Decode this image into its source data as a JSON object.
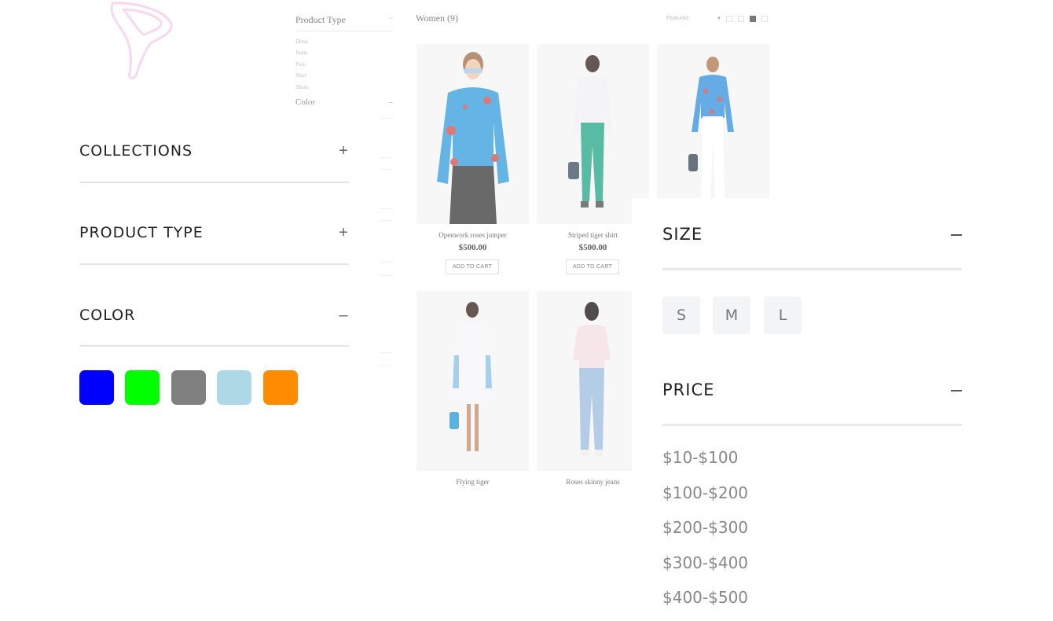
{
  "shop": {
    "filters_small": {
      "product_type_title": "Product Type",
      "types": [
        "Dress",
        "Jeans",
        "Polo",
        "Shirt",
        "Shoes"
      ],
      "color_title": "Color",
      "toggle": "–"
    },
    "heading": "Women (9)",
    "sort_label": "Featured",
    "products": [
      {
        "name": "Openwork roses jumper",
        "price": "$500.00",
        "cta": "ADD TO CART"
      },
      {
        "name": "Striped tiger shirt",
        "price": "$500.00",
        "cta": "ADD TO CART"
      },
      {
        "name": "",
        "price": "",
        "cta": ""
      },
      {
        "name": "Flying tiger",
        "price": "",
        "cta": ""
      },
      {
        "name": "Roses skinny jeans",
        "price": "",
        "cta": ""
      }
    ]
  },
  "left_panel": {
    "collections": {
      "title": "COLLECTIONS",
      "toggle": "+"
    },
    "product_type": {
      "title": "PRODUCT TYPE",
      "toggle": "+"
    },
    "color": {
      "title": "COLOR",
      "toggle": "–"
    },
    "swatches": [
      "#0000ff",
      "#00ff00",
      "#808080",
      "#add8e6",
      "#ff8c00"
    ]
  },
  "right_panel": {
    "size": {
      "title": "SIZE",
      "options": [
        "S",
        "M",
        "L"
      ]
    },
    "price": {
      "title": "PRICE",
      "options": [
        "$10-$100",
        "$100-$200",
        "$200-$300",
        "$300-$400",
        "$400-$500"
      ]
    }
  }
}
